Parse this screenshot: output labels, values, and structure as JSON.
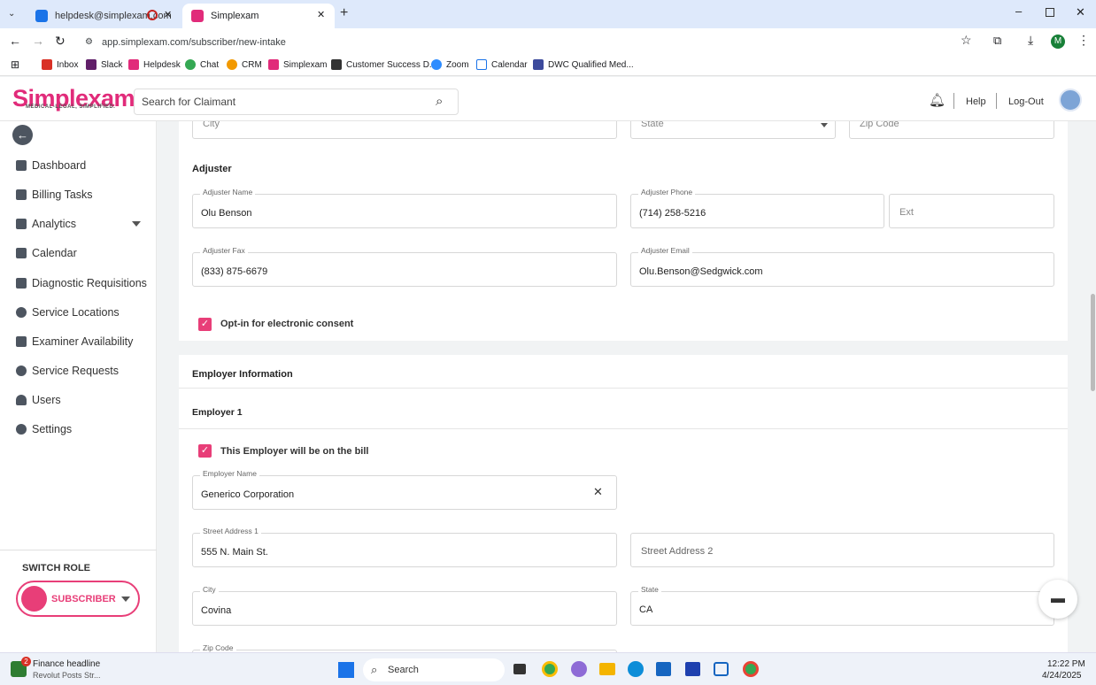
{
  "browser": {
    "tabs": [
      {
        "title": "helpdesk@simplexam.com",
        "active": false
      },
      {
        "title": "Simplexam",
        "active": true
      }
    ],
    "url": "app.simplexam.com/subscriber/new-intake",
    "profile_initial": "M",
    "bookmarks": [
      "Inbox",
      "Slack",
      "Helpdesk",
      "Chat",
      "CRM",
      "Simplexam",
      "Customer Success D...",
      "Zoom",
      "Calendar",
      "DWC Qualified Med..."
    ]
  },
  "app": {
    "logo": "Simplexam",
    "logo_tagline": "MEDICAL-LEGAL, SIMPLIFIED.",
    "search_placeholder": "Search for Claimant",
    "help": "Help",
    "logout": "Log-Out"
  },
  "sidebar": {
    "items": [
      {
        "label": "Dashboard"
      },
      {
        "label": "Billing Tasks"
      },
      {
        "label": "Analytics"
      },
      {
        "label": "Calendar"
      },
      {
        "label": "Diagnostic Requisitions"
      },
      {
        "label": "Service Locations"
      },
      {
        "label": "Examiner Availability"
      },
      {
        "label": "Service Requests"
      },
      {
        "label": "Users"
      },
      {
        "label": "Settings"
      }
    ],
    "switch_role_label": "SWITCH ROLE",
    "role": "SUBSCRIBER"
  },
  "form": {
    "city_placeholder": "City",
    "state_placeholder": "State",
    "zip_placeholder": "Zip Code",
    "adjuster_heading": "Adjuster",
    "adjuster_name_label": "Adjuster Name",
    "adjuster_name": "Olu Benson",
    "adjuster_phone_label": "Adjuster Phone",
    "adjuster_phone": "(714) 258-5216",
    "ext_placeholder": "Ext",
    "adjuster_fax_label": "Adjuster Fax",
    "adjuster_fax": "(833) 875-6679",
    "adjuster_email_label": "Adjuster Email",
    "adjuster_email": "Olu.Benson@Sedgwick.com",
    "consent_label": "Opt-in for electronic consent",
    "employer_info_heading": "Employer Information",
    "employer1_heading": "Employer 1",
    "on_bill_label": "This Employer will be on the bill",
    "employer_name_label": "Employer Name",
    "employer_name": "Generico Corporation",
    "street1_label": "Street Address 1",
    "street1": "555 N. Main St.",
    "street2_placeholder": "Street Address 2",
    "city_label": "City",
    "city": "Covina",
    "state_label": "State",
    "state": "CA",
    "zip_label": "Zip Code"
  },
  "taskbar": {
    "news_title": "Finance headline",
    "news_sub": "Revolut Posts Str...",
    "news_badge": "2",
    "search_label": "Search",
    "time": "12:22 PM",
    "date": "4/24/2025"
  },
  "colors": {
    "accent": "#e83e78",
    "brand": "#e12b7a"
  }
}
